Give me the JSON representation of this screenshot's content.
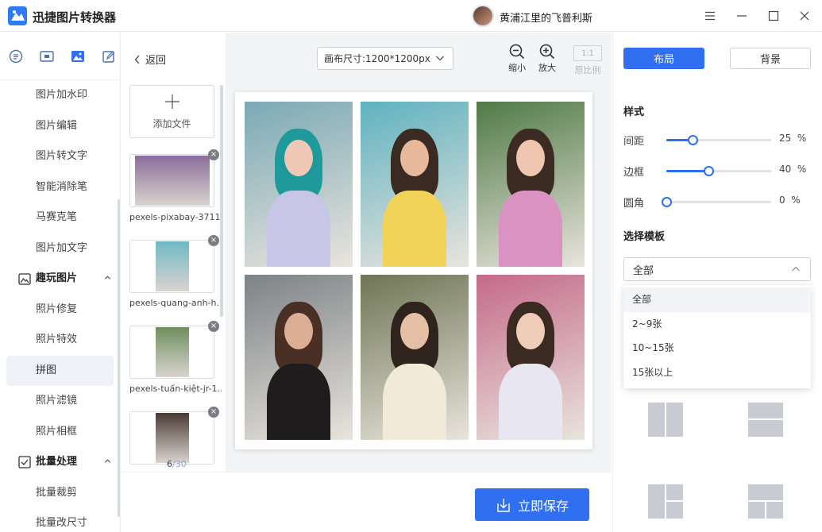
{
  "app": {
    "title": "迅捷图片转换器",
    "user_name": "黄浦江里的飞普利斯"
  },
  "window_controls": [
    "menu-icon",
    "minimize-icon",
    "maximize-icon",
    "close-icon"
  ],
  "sidebar": {
    "top_icons": [
      "list-icon",
      "image-frame-icon",
      "picture-icon",
      "edit-box-icon"
    ],
    "items_before": [
      "图片加水印",
      "图片编辑",
      "图片转文字",
      "智能消除笔",
      "马赛克笔",
      "图片加文字"
    ],
    "group_fun": {
      "label": "趣玩图片",
      "icon": "picture-icon"
    },
    "fun_items": [
      "照片修复",
      "照片特效",
      "拼图",
      "照片滤镜",
      "照片相框"
    ],
    "active_item": "拼图",
    "group_batch": {
      "label": "批量处理",
      "icon": "checkbox-icon"
    },
    "batch_items": [
      "批量裁剪",
      "批量改尺寸"
    ]
  },
  "files": {
    "back_label": "返回",
    "add_label": "添加文件",
    "items": [
      {
        "name": "pexels-pixabay-3711...",
        "tone": "#8a6d9a"
      },
      {
        "name": "pexels-quang-anh-h...",
        "tone": "#6fb9c6"
      },
      {
        "name": "pexels-tuấn-kiệt-jr-1...",
        "tone": "#6f8f5e"
      },
      {
        "name": "",
        "tone": "#4a3a33"
      }
    ],
    "count_current": "6",
    "count_total": "/30"
  },
  "canvas": {
    "size_label": "画布尺寸:1200*1200px",
    "zoom_out": "缩小",
    "zoom_in": "放大",
    "ratio_box": "1:1",
    "ratio_label": "原比例"
  },
  "photos": [
    {
      "bg": "#7aa9b5",
      "hair": "#1f9a9a",
      "dress": "#c8c6e6",
      "skin": "#f0c9b6"
    },
    {
      "bg": "#5fb2c0",
      "hair": "#3a2a22",
      "dress": "#f2d35a",
      "skin": "#e8b89c"
    },
    {
      "bg": "#4f7a45",
      "hair": "#3b2b22",
      "dress": "#d992c2",
      "skin": "#efc7b0"
    },
    {
      "bg": "#7c8286",
      "hair": "#4a3024",
      "dress": "#1e1c1c",
      "skin": "#dcae93"
    },
    {
      "bg": "#6e7554",
      "hair": "#2f241d",
      "dress": "#f1ead8",
      "skin": "#e5bfa4"
    },
    {
      "bg": "#c46a8a",
      "hair": "#3a2a22",
      "dress": "#e8e6f0",
      "skin": "#f0cdb8"
    }
  ],
  "save_label": "立即保存",
  "right": {
    "tab_layout": "布局",
    "tab_background": "背景",
    "style_title": "样式",
    "sliders": [
      {
        "label": "间距",
        "value": 25,
        "value_text": "25  %"
      },
      {
        "label": "边框",
        "value": 40,
        "value_text": "40  %"
      },
      {
        "label": "圆角",
        "value": 0,
        "value_text": "0  %"
      }
    ],
    "template_title": "选择模板",
    "template_selected": "全部",
    "template_options": [
      "全部",
      "2~9张",
      "10~15张",
      "15张以上"
    ],
    "accent": "#2f6ff0"
  }
}
